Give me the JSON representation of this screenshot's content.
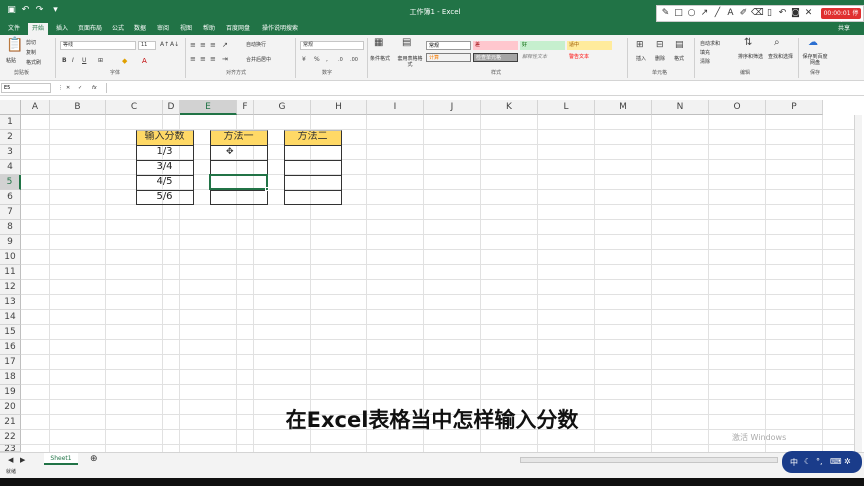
{
  "window": {
    "title": "工作簿1 - Excel"
  },
  "recorder": {
    "timer": "00:00:01 停止"
  },
  "menu": {
    "tabs": [
      "文件",
      "开始",
      "插入",
      "页面布局",
      "公式",
      "数据",
      "审阅",
      "视图",
      "帮助",
      "百度网盘",
      "操作说明搜索"
    ],
    "user": "共享"
  },
  "ribbon": {
    "clipboard": {
      "paste": "粘贴",
      "cut": "剪切",
      "copy": "复制",
      "format_painter": "格式刷",
      "group": "剪贴板"
    },
    "font": {
      "name": "等线",
      "size": "11",
      "group": "字体"
    },
    "alignment": {
      "wrap": "自动换行",
      "merge": "合并后居中",
      "group": "对齐方式"
    },
    "number": {
      "format": "常规",
      "group": "数字"
    },
    "styles": {
      "conditional": "条件格式",
      "table": "套用表格格式",
      "normal": "常规",
      "bad": "差",
      "good": "好",
      "neutral": "适中",
      "calc": "计算",
      "check": "检查单元格",
      "explain": "解释性文本",
      "warn": "警告文本",
      "group": "样式"
    },
    "cells": {
      "insert": "插入",
      "delete": "删除",
      "format": "格式",
      "group": "单元格"
    },
    "editing": {
      "autosum": "自动求和",
      "fill": "填充",
      "clear": "清除",
      "sort": "排序和筛选",
      "find": "查找和选择",
      "group": "编辑"
    },
    "save": {
      "label": "保存到百度网盘",
      "group": "保存"
    }
  },
  "formula_bar": {
    "name_box": "E5",
    "fx": "fx"
  },
  "columns": [
    "A",
    "B",
    "C",
    "D",
    "E",
    "F",
    "G",
    "H",
    "I",
    "J",
    "K",
    "L",
    "M",
    "N",
    "O",
    "P"
  ],
  "rows": [
    "1",
    "2",
    "3",
    "4",
    "5",
    "6",
    "7",
    "8",
    "9",
    "10",
    "11",
    "12",
    "13",
    "14",
    "15",
    "16",
    "17",
    "18",
    "19",
    "20",
    "21",
    "22",
    "23"
  ],
  "table": {
    "c_header": "输入分数",
    "e_header": "方法一",
    "g_header": "方法二",
    "c_values": [
      "1/3",
      "3/4",
      "4/5",
      "5/6"
    ]
  },
  "sheet": {
    "tab": "Sheet1",
    "status": "就绪"
  },
  "subtitle": "在Excel表格当中怎样输入分数",
  "watermark": "激活 Windows",
  "ime": {
    "label": "中"
  },
  "colors": {
    "excel_green": "#217346",
    "header_fill": "#ffd966",
    "bad_fill": "#ffc7ce",
    "good_fill": "#c6efce",
    "neutral_fill": "#ffeb9c",
    "calc_fill": "#f2f2f2",
    "check_fill": "#a5a5a5"
  }
}
